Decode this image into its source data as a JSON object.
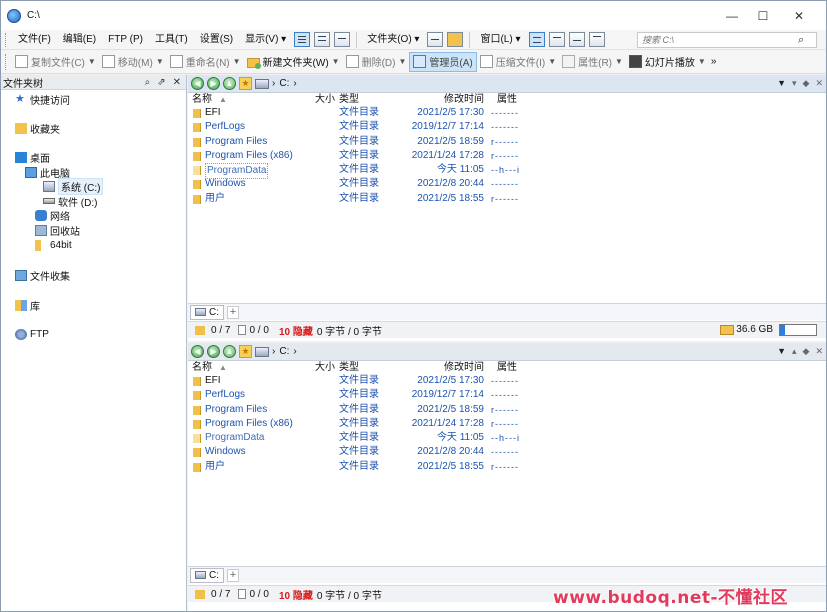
{
  "window": {
    "title": "C:\\",
    "minimize": "—",
    "maximize": "☐",
    "close": "✕"
  },
  "menu": [
    "文件(F)",
    "编辑(E)",
    "FTP (P)",
    "工具(T)",
    "设置(S)",
    "显示(V) ▾",
    "文件夹(O) ▾",
    "窗口(L) ▾"
  ],
  "search": {
    "placeholder": "搜索 C:\\"
  },
  "toolbar": {
    "copy": "复制文件(C)",
    "move": "移动(M)",
    "rename": "重命名(N)",
    "newfolder": "新建文件夹(W)",
    "delete": "删除(D)",
    "admin": "管理员(A)",
    "compress": "压缩文件(I)",
    "props": "属性(R)",
    "slideshow": "幻灯片播放"
  },
  "left": {
    "title": "文件夹树",
    "icons": [
      "⌕",
      "⇗",
      "✕"
    ],
    "tree": [
      {
        "label": "快捷访问",
        "icon": "star-icon"
      },
      {
        "label": "收藏夹",
        "icon": "folder-icon"
      },
      {
        "label": "桌面",
        "icon": "desktop-icon"
      },
      {
        "label": "此电脑",
        "icon": "computer-icon"
      },
      {
        "label": "系统 (C:)",
        "icon": "drive-icon"
      },
      {
        "label": "软件 (D:)",
        "icon": "drive-icon"
      },
      {
        "label": "网络",
        "icon": "network-icon"
      },
      {
        "label": "回收站",
        "icon": "recycle-bin-icon"
      },
      {
        "label": "64bit",
        "icon": "folder-icon"
      },
      {
        "label": "文件收集",
        "icon": "collection-icon"
      },
      {
        "label": "库",
        "icon": "library-icon"
      },
      {
        "label": "FTP",
        "icon": "ftp-icon"
      }
    ]
  },
  "pane": {
    "path": "C:",
    "columns": {
      "name": "名称",
      "size": "大小",
      "type": "类型",
      "modified": "修改时间",
      "attr": "属性"
    },
    "rows": [
      {
        "name": "EFI",
        "type": "文件目录",
        "modified": "2021/2/5  17:30",
        "attr": "-------"
      },
      {
        "name": "PerfLogs",
        "type": "文件目录",
        "modified": "2019/12/7  17:14",
        "attr": "-------"
      },
      {
        "name": "Program Files",
        "type": "文件目录",
        "modified": "2021/2/5  18:59",
        "attr": "r------"
      },
      {
        "name": "Program Files (x86)",
        "type": "文件目录",
        "modified": "2021/1/24  17:28",
        "attr": "r------"
      },
      {
        "name": "ProgramData",
        "type": "文件目录",
        "modified": "今天  11:05",
        "attr": "--h---i"
      },
      {
        "name": "Windows",
        "type": "文件目录",
        "modified": "2021/2/8  20:44",
        "attr": "-------"
      },
      {
        "name": "用户",
        "type": "文件目录",
        "modified": "2021/2/5  18:55",
        "attr": "r------"
      }
    ],
    "tab": "C:",
    "tab_add": "+",
    "status": {
      "folders": "0 / 7",
      "files": "0 / 0",
      "hidden": "10 隐藏",
      "bytes": "0 字节 / 0 字节",
      "free": "36.6 GB"
    }
  },
  "watermark": "www.budoq.net-不懂社区",
  "colors": {
    "accent": "#2f7fd8",
    "hidden": "#d81c1c",
    "link": "#1c53b0"
  }
}
